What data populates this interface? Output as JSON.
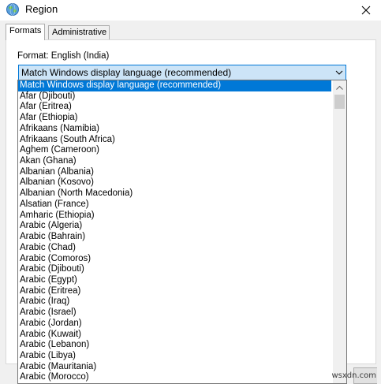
{
  "window": {
    "title": "Region"
  },
  "tabs": [
    {
      "label": "Formats",
      "active": true
    },
    {
      "label": "Administrative",
      "active": false
    }
  ],
  "format": {
    "label": "Format: English (India)",
    "selected_value": "Match Windows display language (recommended)"
  },
  "dropdown": {
    "options": [
      "Match Windows display language (recommended)",
      "Afar (Djibouti)",
      "Afar (Eritrea)",
      "Afar (Ethiopia)",
      "Afrikaans (Namibia)",
      "Afrikaans (South Africa)",
      "Aghem (Cameroon)",
      "Akan (Ghana)",
      "Albanian (Albania)",
      "Albanian (Kosovo)",
      "Albanian (North Macedonia)",
      "Alsatian (France)",
      "Amharic (Ethiopia)",
      "Arabic (Algeria)",
      "Arabic (Bahrain)",
      "Arabic (Chad)",
      "Arabic (Comoros)",
      "Arabic (Djibouti)",
      "Arabic (Egypt)",
      "Arabic (Eritrea)",
      "Arabic (Iraq)",
      "Arabic (Israel)",
      "Arabic (Jordan)",
      "Arabic (Kuwait)",
      "Arabic (Lebanon)",
      "Arabic (Libya)",
      "Arabic (Mauritania)",
      "Arabic (Morocco)"
    ],
    "selected_index": 0
  },
  "icons": {
    "app": "globe-icon",
    "close": "close-icon",
    "combo_arrow": "chevron-down-icon",
    "scroll_up": "scroll-up-arrow-icon"
  },
  "colors": {
    "accent": "#0078d7",
    "combo_fill": "#cce4f7"
  },
  "watermark": "wsxdn.com"
}
